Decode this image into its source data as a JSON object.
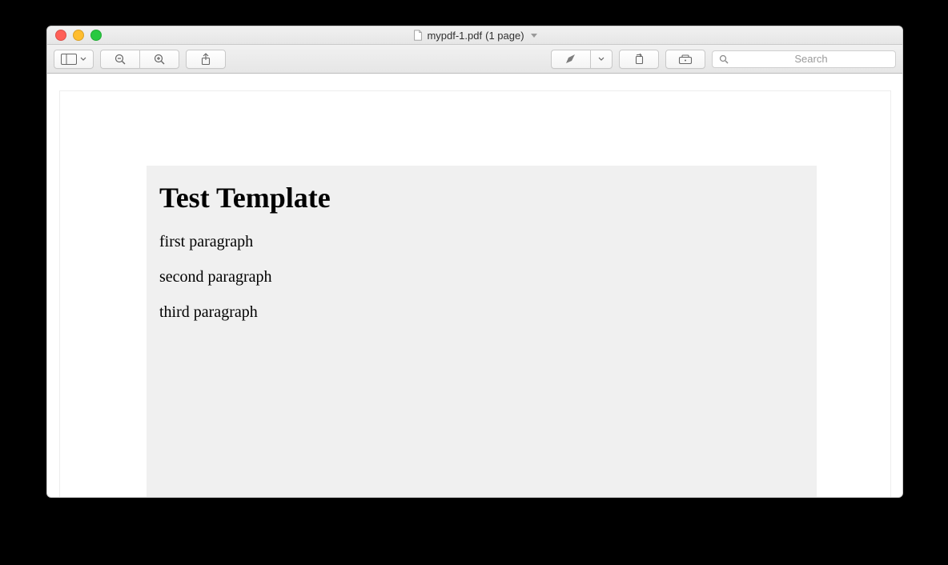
{
  "window": {
    "filename": "mypdf-1.pdf",
    "page_count_label": "(1 page)"
  },
  "toolbar": {
    "search_placeholder": "Search"
  },
  "document": {
    "heading": "Test Template",
    "paragraphs": [
      "first paragraph",
      "second paragraph",
      "third paragraph"
    ]
  }
}
